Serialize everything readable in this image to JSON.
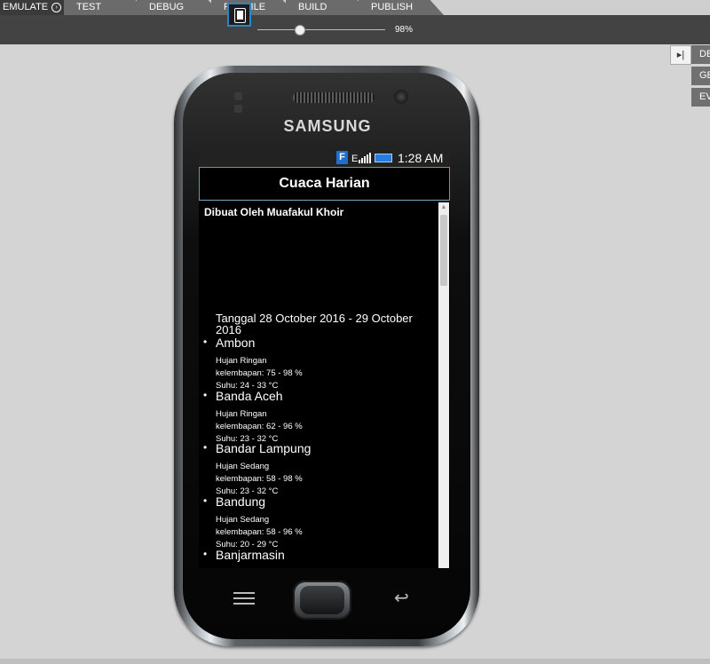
{
  "tabs": [
    {
      "label": "EMULATE",
      "active": true,
      "icon": "circle-arrow-icon"
    },
    {
      "label": "TEST"
    },
    {
      "label": "DEBUG"
    },
    {
      "label": "PROFILE"
    },
    {
      "label": "BUILD"
    },
    {
      "label": "PUBLISH"
    }
  ],
  "toolbar": {
    "zoom": "98%",
    "zoom_fraction": 0.38
  },
  "side_panel": {
    "tabs": [
      "DE",
      "GE",
      "EV"
    ]
  },
  "phone": {
    "brand": "SAMSUNG",
    "status": {
      "time": "1:28 AM",
      "f_label": "F",
      "e_label": "E"
    },
    "app_title": "Cuaca Harian",
    "credit": "Dibuat Oleh Muafakul Khoir",
    "date_range": "Tanggal 28 October 2016 - 29 October 2016",
    "cities": [
      {
        "name": "Ambon",
        "condition": "Hujan Ringan",
        "humidity": "kelembapan: 75 - 98 %",
        "temp": "Suhu: 24 - 33 °C"
      },
      {
        "name": "Banda Aceh",
        "condition": "Hujan Ringan",
        "humidity": "kelembapan: 62 - 96 %",
        "temp": "Suhu: 23 - 32 °C"
      },
      {
        "name": "Bandar Lampung",
        "condition": "Hujan Sedang",
        "humidity": "kelembapan: 58 - 98 %",
        "temp": "Suhu: 23 - 32 °C"
      },
      {
        "name": "Bandung",
        "condition": "Hujan Sedang",
        "humidity": "kelembapan: 58 - 96 %",
        "temp": "Suhu: 20 - 29 °C"
      },
      {
        "name": "Banjarmasin",
        "condition": "",
        "humidity": "",
        "temp": ""
      }
    ]
  },
  "colors": {
    "accent": "#2e86c1",
    "toolbar": "#434343",
    "tab": "#6b6b6b"
  }
}
